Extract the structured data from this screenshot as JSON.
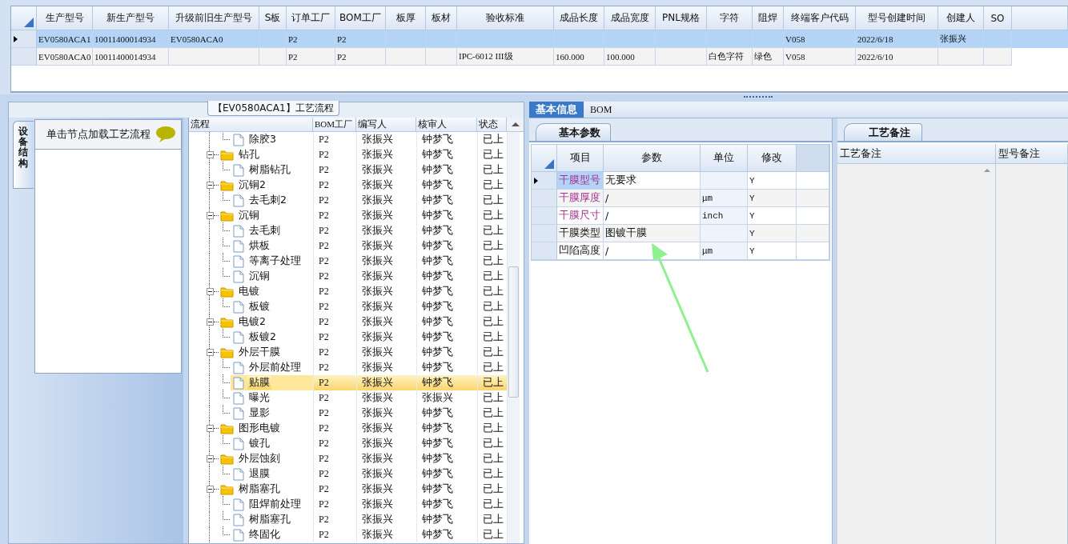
{
  "top_grid": {
    "columns": [
      "生产型号",
      "新生产型号",
      "升级前旧生产型号",
      "S板",
      "订单工厂",
      "BOM工厂",
      "板厚",
      "板材",
      "验收标准",
      "成品长度",
      "成品宽度",
      "PNL规格",
      "字符",
      "阻焊",
      "终端客户代码",
      "型号创建时间",
      "创建人",
      "SO"
    ],
    "rows": [
      {
        "selected": true,
        "cells": [
          "EV0580ACA1",
          "10011400014934",
          "EV0580ACA0",
          null,
          "P2",
          "P2",
          null,
          null,
          null,
          null,
          null,
          null,
          null,
          null,
          "V058",
          "2022/6/18",
          "张振兴",
          null
        ]
      },
      {
        "selected": false,
        "cells": [
          "EV0580ACA0",
          "10011400014934",
          null,
          null,
          "P2",
          "P2",
          null,
          null,
          "IPC-6012 III级",
          "160.000",
          "100.000",
          null,
          "白色字符",
          "绿色",
          "V058",
          "2022/6/10",
          null,
          null
        ]
      }
    ]
  },
  "process_panel": {
    "title": "【EV0580ACA1】工艺流程"
  },
  "side_tabs": [
    {
      "label": "设备结构",
      "selected": true
    }
  ],
  "hint": "单击节点加载工艺流程",
  "tree": {
    "columns": [
      "流程",
      "BOM工厂",
      "编写人",
      "核审人",
      "状态"
    ],
    "nodes": [
      {
        "children": [
          {
            "name": "除胶3",
            "bom": "P2",
            "writer": "张振兴",
            "reviewer": "钟梦飞",
            "status": "已上",
            "selected": false
          }
        ]
      },
      {
        "name": "钻孔",
        "bom": "P2",
        "writer": "张振兴",
        "reviewer": "钟梦飞",
        "status": "已上",
        "selected": false,
        "expanded": true,
        "children": [
          {
            "name": "树脂钻孔",
            "bom": "P2",
            "writer": "张振兴",
            "reviewer": "钟梦飞",
            "status": "已上",
            "selected": false
          }
        ]
      },
      {
        "name": "沉铜2",
        "bom": "P2",
        "writer": "张振兴",
        "reviewer": "钟梦飞",
        "status": "已上",
        "selected": false,
        "expanded": true,
        "children": [
          {
            "name": "去毛刺2",
            "bom": "P2",
            "writer": "张振兴",
            "reviewer": "钟梦飞",
            "status": "已上",
            "selected": false
          }
        ]
      },
      {
        "name": "沉铜",
        "bom": "P2",
        "writer": "张振兴",
        "reviewer": "钟梦飞",
        "status": "已上",
        "selected": false,
        "expanded": true,
        "children": [
          {
            "name": "去毛刺",
            "bom": "P2",
            "writer": "张振兴",
            "reviewer": "钟梦飞",
            "status": "已上",
            "selected": false
          },
          {
            "name": "烘板",
            "bom": "P2",
            "writer": "张振兴",
            "reviewer": "钟梦飞",
            "status": "已上",
            "selected": false
          },
          {
            "name": "等离子处理",
            "bom": "P2",
            "writer": "张振兴",
            "reviewer": "钟梦飞",
            "status": "已上",
            "selected": false
          },
          {
            "name": "沉铜",
            "bom": "P2",
            "writer": "张振兴",
            "reviewer": "钟梦飞",
            "status": "已上",
            "selected": false
          }
        ]
      },
      {
        "name": "电镀",
        "bom": "P2",
        "writer": "张振兴",
        "reviewer": "钟梦飞",
        "status": "已上",
        "selected": false,
        "expanded": true,
        "children": [
          {
            "name": "板镀",
            "bom": "P2",
            "writer": "张振兴",
            "reviewer": "钟梦飞",
            "status": "已上",
            "selected": false
          }
        ]
      },
      {
        "name": "电镀2",
        "bom": "P2",
        "writer": "张振兴",
        "reviewer": "钟梦飞",
        "status": "已上",
        "selected": false,
        "expanded": true,
        "children": [
          {
            "name": "板镀2",
            "bom": "P2",
            "writer": "张振兴",
            "reviewer": "钟梦飞",
            "status": "已上",
            "selected": false
          }
        ]
      },
      {
        "name": "外层干膜",
        "bom": "P2",
        "writer": "张振兴",
        "reviewer": "钟梦飞",
        "status": "已上",
        "selected": false,
        "expanded": true,
        "children": [
          {
            "name": "外层前处理",
            "bom": "P2",
            "writer": "张振兴",
            "reviewer": "钟梦飞",
            "status": "已上",
            "selected": false
          },
          {
            "name": "贴膜",
            "bom": "P2",
            "writer": "张振兴",
            "reviewer": "钟梦飞",
            "status": "已上",
            "selected": true
          },
          {
            "name": "曝光",
            "bom": "P2",
            "writer": "张振兴",
            "reviewer": "张振兴",
            "status": "已上",
            "selected": false
          },
          {
            "name": "显影",
            "bom": "P2",
            "writer": "张振兴",
            "reviewer": "钟梦飞",
            "status": "已上",
            "selected": false
          }
        ]
      },
      {
        "name": "图形电镀",
        "bom": "P2",
        "writer": "张振兴",
        "reviewer": "钟梦飞",
        "status": "已上",
        "selected": false,
        "expanded": true,
        "children": [
          {
            "name": "镀孔",
            "bom": "P2",
            "writer": "张振兴",
            "reviewer": "钟梦飞",
            "status": "已上",
            "selected": false
          }
        ]
      },
      {
        "name": "外层蚀刻",
        "bom": "P2",
        "writer": "张振兴",
        "reviewer": "钟梦飞",
        "status": "已上",
        "selected": false,
        "expanded": true,
        "children": [
          {
            "name": "退膜",
            "bom": "P2",
            "writer": "张振兴",
            "reviewer": "钟梦飞",
            "status": "已上",
            "selected": false
          }
        ]
      },
      {
        "name": "树脂塞孔",
        "bom": "P2",
        "writer": "张振兴",
        "reviewer": "钟梦飞",
        "status": "已上",
        "selected": false,
        "expanded": true,
        "children": [
          {
            "name": "阻焊前处理",
            "bom": "P2",
            "writer": "张振兴",
            "reviewer": "钟梦飞",
            "status": "已上",
            "selected": false
          },
          {
            "name": "树脂塞孔",
            "bom": "P2",
            "writer": "张振兴",
            "reviewer": "钟梦飞",
            "status": "已上",
            "selected": false
          },
          {
            "name": "终固化",
            "bom": "P2",
            "writer": "张振兴",
            "reviewer": "钟梦飞",
            "status": "已上",
            "selected": false
          }
        ]
      }
    ]
  },
  "tabs": [
    {
      "label": "基本信息",
      "selected": true
    },
    {
      "label": "BOM",
      "selected": false
    }
  ],
  "params": {
    "tab": "基本参数",
    "columns": [
      "项目",
      "参数",
      "单位",
      "修改"
    ],
    "rows": [
      {
        "item": "干膜型号",
        "value": "无要求",
        "modify": "Y",
        "required": true,
        "selected": true
      },
      {
        "item": "干膜厚度",
        "value": "/",
        "unit": "μm",
        "modify": "Y",
        "required": true,
        "selected": false
      },
      {
        "item": "干膜尺寸",
        "value": "/",
        "unit": "inch",
        "modify": "Y",
        "required": true,
        "selected": false
      },
      {
        "item": "干膜类型",
        "value": "图镀干膜",
        "modify": "Y",
        "required": false,
        "selected": false
      },
      {
        "item": "凹陷高度",
        "value": "/",
        "unit": "μm",
        "modify": "Y",
        "required": false,
        "selected": false
      }
    ]
  },
  "notes": {
    "tab": "工艺备注",
    "columns": [
      "工艺备注",
      "型号备注"
    ]
  }
}
